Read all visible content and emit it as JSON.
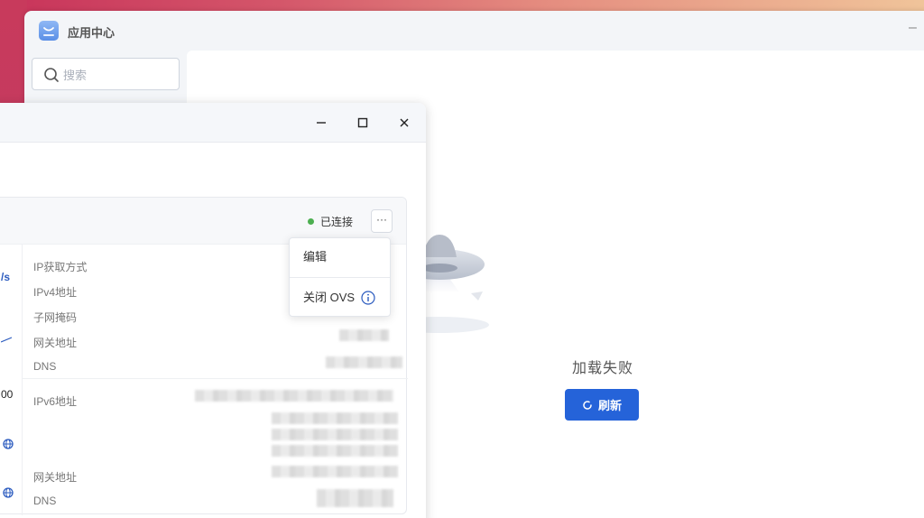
{
  "colors": {
    "accent": "#2563d9",
    "status_connected": "#4caf50"
  },
  "app_center": {
    "title": "应用中心",
    "logo_icon": "shopping-bag-icon",
    "search_placeholder": "搜索",
    "empty_state": {
      "message": "加载失败",
      "refresh_label": "刷新",
      "illustration": "ufo-illustration"
    }
  },
  "network_window": {
    "controls": [
      "minimize-icon",
      "maximize-icon",
      "close-icon"
    ],
    "interface_card": {
      "status": "已连接",
      "more_label": "···",
      "ipv4_section": {
        "labels": [
          "IP获取方式",
          "IPv4地址",
          "子网掩码",
          "网关地址",
          "DNS"
        ]
      },
      "ipv6_section": {
        "labels": [
          "IPv6地址",
          "网关地址",
          "DNS"
        ]
      },
      "left_partial": {
        "speed_unit": "/s",
        "value": "00"
      }
    },
    "dropdown_menu": {
      "items": [
        {
          "label": "编辑"
        },
        {
          "label": "关闭 OVS",
          "icon": "info-icon"
        }
      ]
    }
  }
}
